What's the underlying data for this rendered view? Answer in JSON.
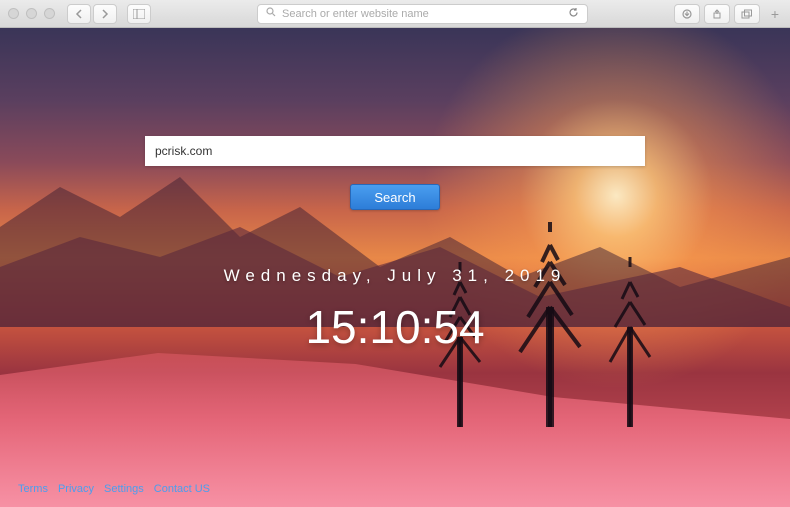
{
  "browser": {
    "address_placeholder": "Search or enter website name"
  },
  "search": {
    "input_value": "pcrisk.com",
    "button_label": "Search"
  },
  "datetime": {
    "date": "Wednesday, July 31, 2019",
    "time": "15:10:54"
  },
  "footer": {
    "links": [
      {
        "label": "Terms"
      },
      {
        "label": "Privacy"
      },
      {
        "label": "Settings"
      },
      {
        "label": "Contact US"
      }
    ]
  }
}
